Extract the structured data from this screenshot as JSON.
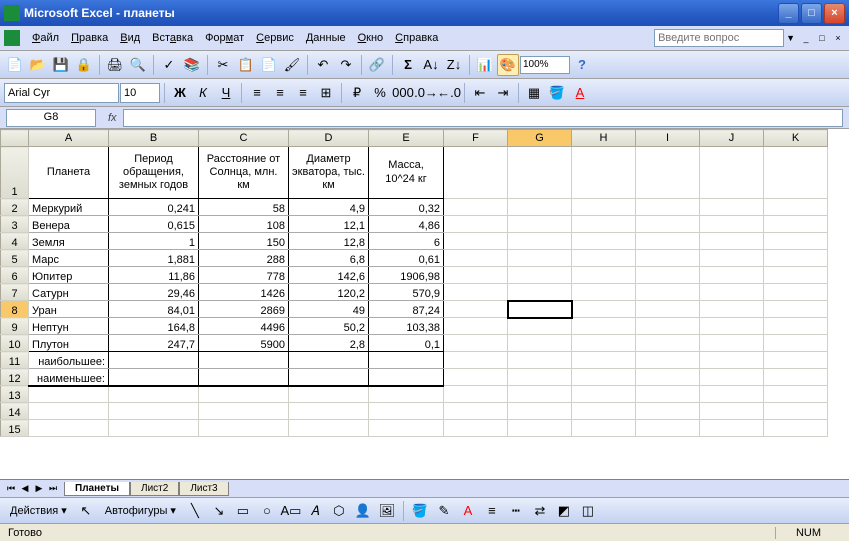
{
  "titlebar": {
    "app": "Microsoft Excel",
    "doc": "планеты"
  },
  "menubar": {
    "file": "Файл",
    "edit": "Правка",
    "view": "Вид",
    "insert": "Вставка",
    "format": "Формат",
    "tools": "Сервис",
    "data": "Данные",
    "window": "Окно",
    "help": "Справка",
    "help_placeholder": "Введите вопрос"
  },
  "toolbar": {
    "zoom": "100%"
  },
  "format_bar": {
    "font_name": "Arial Cyr",
    "font_size": "10"
  },
  "namebox": {
    "ref": "G8"
  },
  "columns": [
    "A",
    "B",
    "C",
    "D",
    "E",
    "F",
    "G",
    "H",
    "I",
    "J",
    "K"
  ],
  "active": {
    "col": "G",
    "row": 8
  },
  "chart_data": {
    "type": "table",
    "headers": {
      "planet": "Планета",
      "period": "Период обращения, земных годов",
      "distance": "Расстояние от Солнца, млн. км",
      "diameter": "Диаметр экватора, тыс. км",
      "mass": "Масса, 10^24 кг"
    },
    "rows": [
      {
        "planet": "Меркурий",
        "period": "0,241",
        "distance": "58",
        "diameter": "4,9",
        "mass": "0,32"
      },
      {
        "planet": "Венера",
        "period": "0,615",
        "distance": "108",
        "diameter": "12,1",
        "mass": "4,86"
      },
      {
        "planet": "Земля",
        "period": "1",
        "distance": "150",
        "diameter": "12,8",
        "mass": "6"
      },
      {
        "planet": "Марс",
        "period": "1,881",
        "distance": "288",
        "diameter": "6,8",
        "mass": "0,61"
      },
      {
        "planet": "Юпитер",
        "period": "11,86",
        "distance": "778",
        "diameter": "142,6",
        "mass": "1906,98"
      },
      {
        "planet": "Сатурн",
        "period": "29,46",
        "distance": "1426",
        "diameter": "120,2",
        "mass": "570,9"
      },
      {
        "planet": "Уран",
        "period": "84,01",
        "distance": "2869",
        "diameter": "49",
        "mass": "87,24"
      },
      {
        "planet": "Нептун",
        "period": "164,8",
        "distance": "4496",
        "diameter": "50,2",
        "mass": "103,38"
      },
      {
        "planet": "Плутон",
        "period": "247,7",
        "distance": "5900",
        "diameter": "2,8",
        "mass": "0,1"
      }
    ],
    "summary": {
      "max_label": "наибольшее:",
      "min_label": "наименьшее:"
    }
  },
  "sheets": {
    "s1": "Планеты",
    "s2": "Лист2",
    "s3": "Лист3"
  },
  "drawbar": {
    "actions": "Действия",
    "autoshapes": "Автофигуры"
  },
  "status": {
    "ready": "Готово",
    "num": "NUM"
  }
}
